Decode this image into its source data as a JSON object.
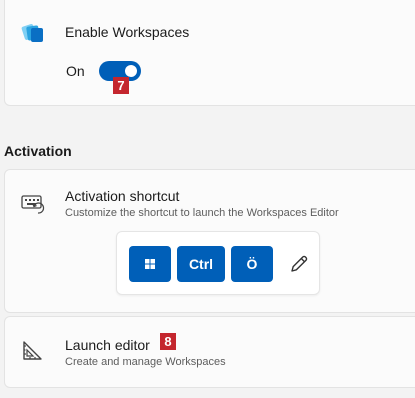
{
  "enable_workspaces": {
    "title": "Enable Workspaces",
    "icon": "workspaces-icon",
    "toggle": {
      "state_label": "On",
      "checked": true,
      "color": "#005fb8"
    },
    "badge": "7"
  },
  "activation_section": {
    "heading": "Activation"
  },
  "activation_shortcut": {
    "title": "Activation shortcut",
    "subtitle": "Customize the shortcut to launch the Workspaces Editor",
    "icon": "keyboard-shortcut-icon",
    "keys": [
      "win-logo-icon",
      "Ctrl",
      "Ö"
    ],
    "key_labels": {
      "ctrl": "Ctrl",
      "o_umlaut": "Ö"
    },
    "edit_icon": "pencil-icon",
    "key_color": "#005fb8"
  },
  "launch_editor": {
    "title": "Launch editor",
    "subtitle": "Create and manage Workspaces",
    "icon": "ruler-square-icon",
    "badge": "8"
  },
  "colors": {
    "accent": "#005fb8",
    "badge": "#c4262e",
    "background": "#f3f3f3",
    "card": "#fbfbfb"
  }
}
